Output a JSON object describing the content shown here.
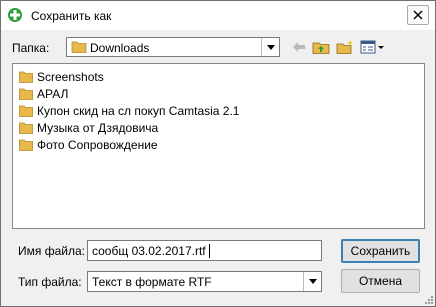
{
  "window": {
    "title": "Сохранить как"
  },
  "look_in": {
    "label": "Папка:",
    "value": "Downloads"
  },
  "files": [
    {
      "name": "Screenshots"
    },
    {
      "name": "АРАЛ"
    },
    {
      "name": "Купон скид на сл покуп Camtasia 2.1"
    },
    {
      "name": "Музыка от Дзядовича"
    },
    {
      "name": "Фото Сопровождение"
    }
  ],
  "filename": {
    "label": "Имя файла:",
    "value": "сообщ 03.02.2017.rtf"
  },
  "filetype": {
    "label": "Тип файла:",
    "value": "Текст в формате RTF"
  },
  "buttons": {
    "save": "Сохранить",
    "cancel": "Отмена"
  },
  "colors": {
    "folder": "#e8b84a",
    "accent": "#3c7fb1",
    "icon_green": "#2e9a3a"
  }
}
